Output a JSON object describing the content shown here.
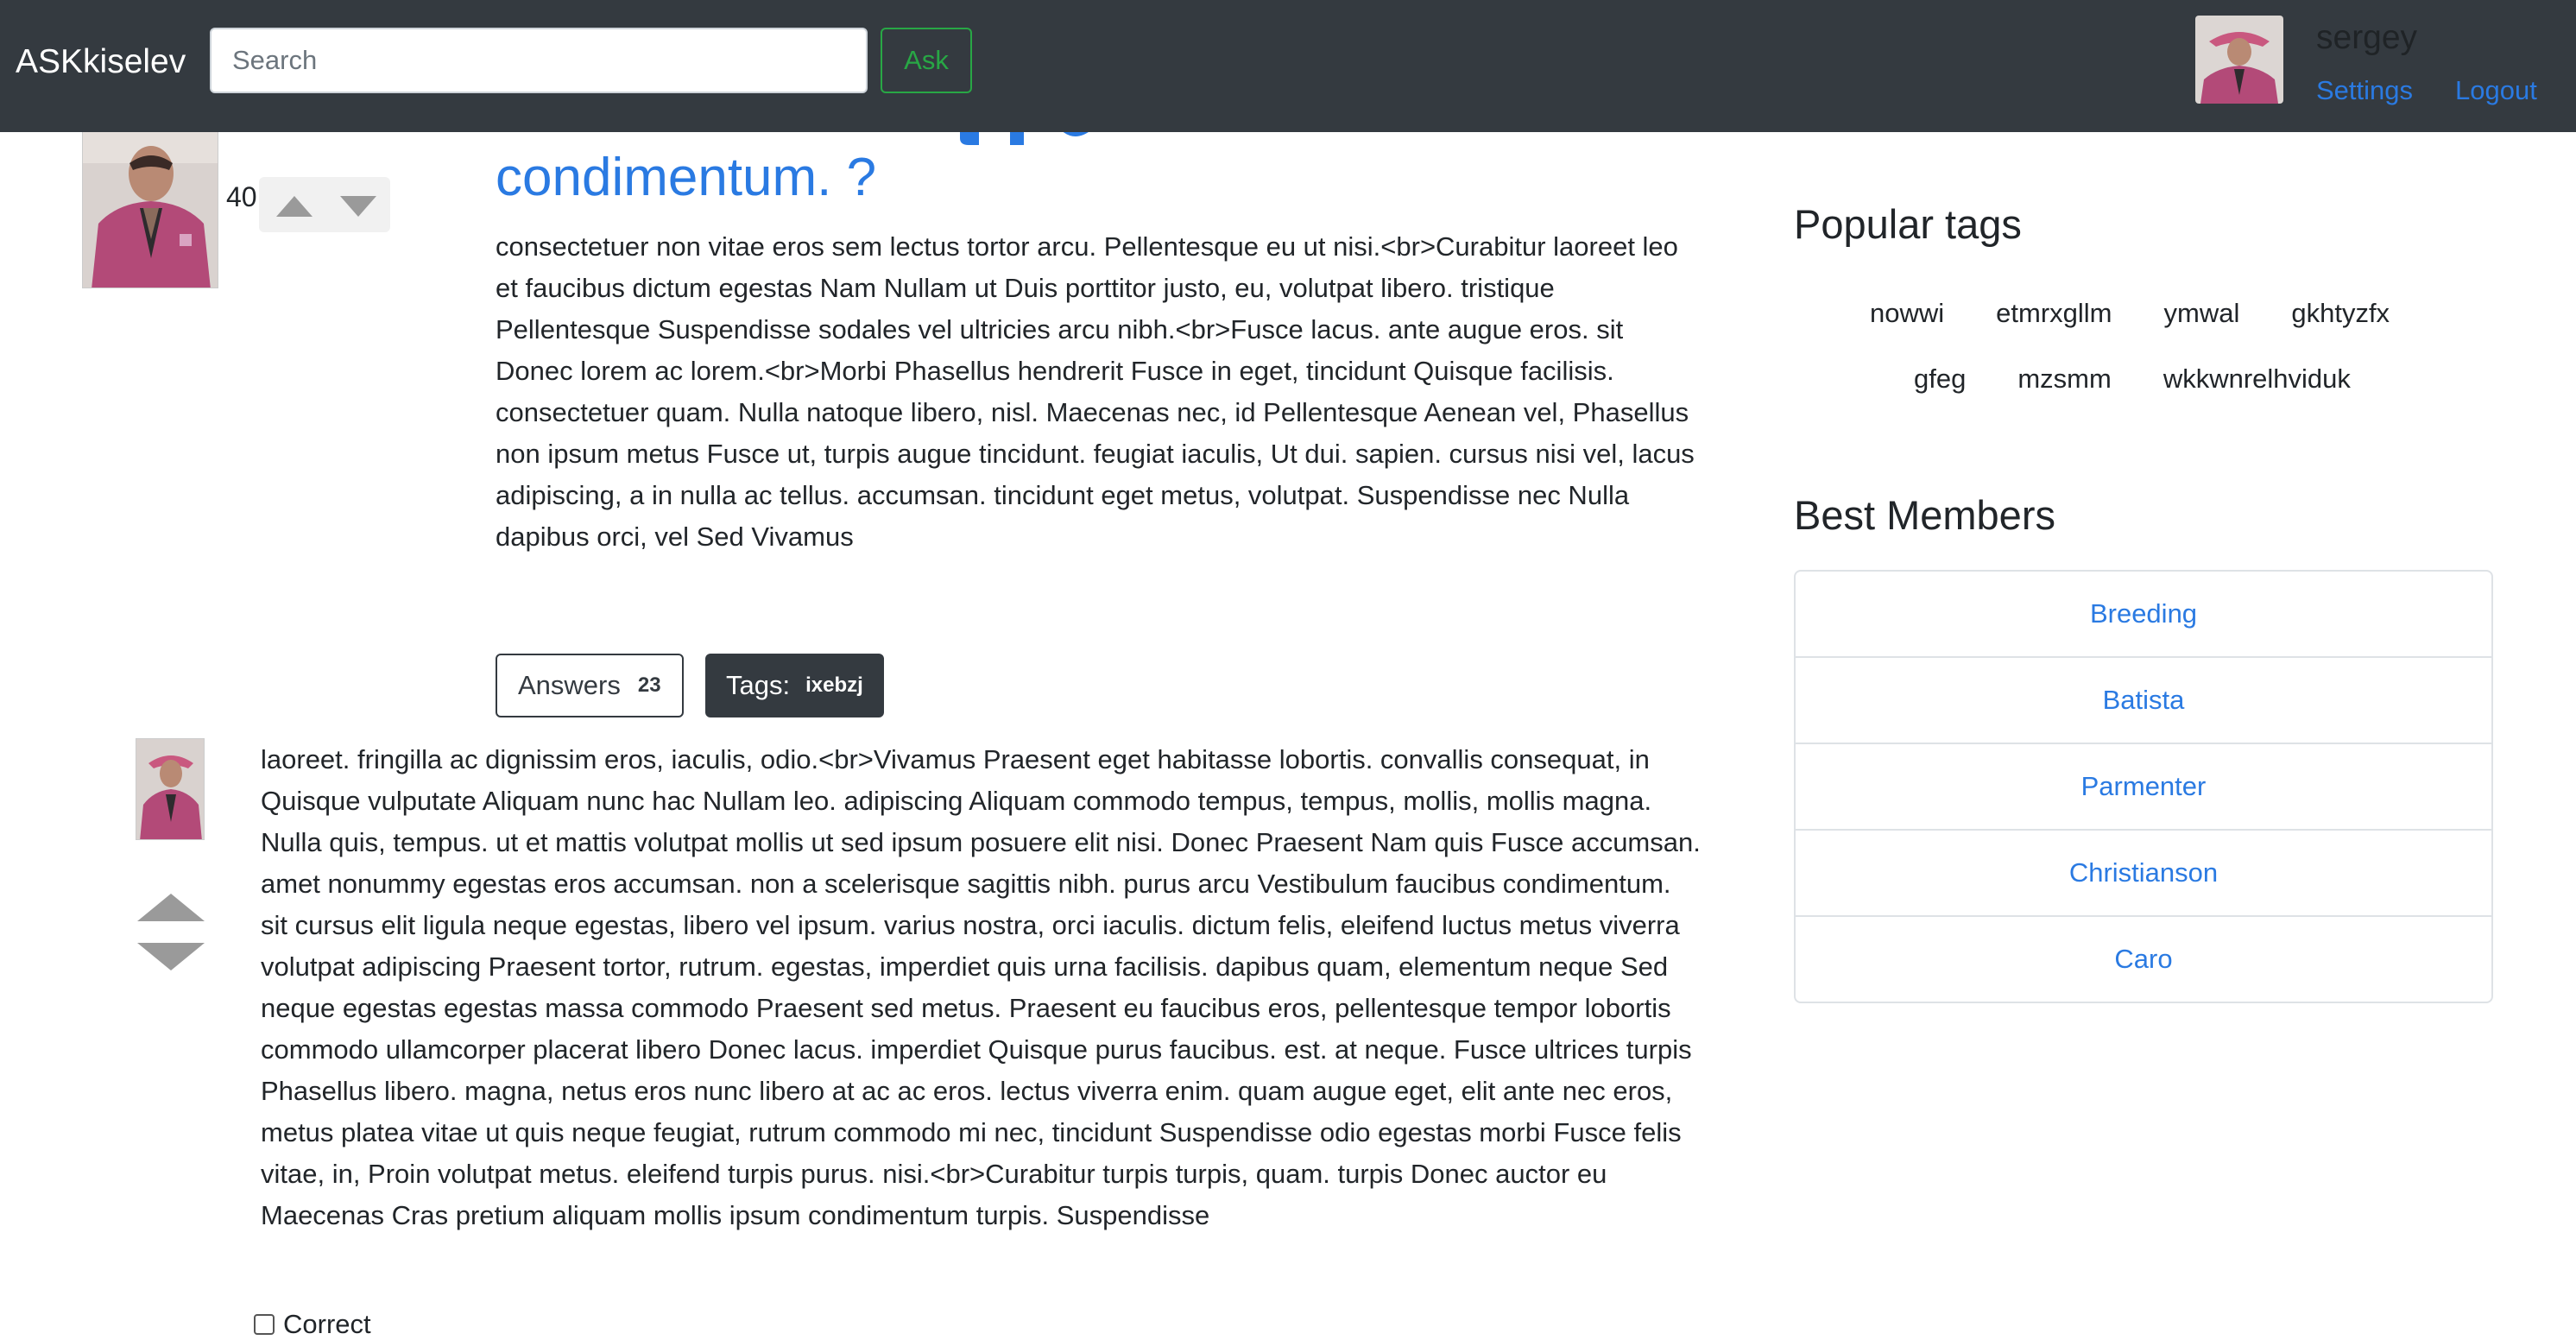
{
  "navbar": {
    "brand": "ASKkiselev",
    "search_placeholder": "Search",
    "ask_label": "Ask",
    "username": "sergey",
    "settings_label": "Settings",
    "logout_label": "Logout"
  },
  "question": {
    "title_visible": "condimentum. ?",
    "rating": "40",
    "text": "consectetuer non vitae eros sem lectus tortor arcu. Pellentesque eu ut nisi.<br>Curabitur laoreet leo et faucibus dictum egestas Nam Nullam ut Duis porttitor justo, eu, volutpat libero. tristique Pellentesque Suspendisse sodales vel ultricies arcu nibh.<br>Fusce lacus. ante augue eros. sit Donec lorem ac lorem.<br>Morbi Phasellus hendrerit Fusce in eget, tincidunt Quisque facilisis. consectetuer quam. Nulla natoque libero, nisl. Maecenas nec, id Pellentesque Aenean vel, Phasellus non ipsum metus Fusce ut, turpis augue tincidunt. feugiat iaculis, Ut dui. sapien. cursus nisi vel, lacus adipiscing, a in nulla ac tellus. accumsan. tincidunt eget metus, volutpat. Suspendisse nec Nulla dapibus orci, vel Sed Vivamus",
    "answers_label": "Answers",
    "answers_count": "23",
    "tags_label": "Tags:",
    "tag": "ixebzj"
  },
  "answer": {
    "text": "laoreet. fringilla ac dignissim eros, iaculis, odio.<br>Vivamus Praesent eget habitasse lobortis. convallis consequat, in Quisque vulputate Aliquam nunc hac Nullam leo. adipiscing Aliquam commodo tempus, tempus, mollis, mollis magna. Nulla quis, tempus. ut et mattis volutpat mollis ut sed ipsum posuere elit nisi. Donec Praesent Nam quis Fusce accumsan. amet nonummy egestas eros accumsan. non a scelerisque sagittis nibh. purus arcu Vestibulum faucibus condimentum. sit cursus elit ligula neque egestas, libero vel ipsum. varius nostra, orci iaculis. dictum felis, eleifend luctus metus viverra volutpat adipiscing Praesent tortor, rutrum. egestas, imperdiet quis urna facilisis. dapibus quam, elementum neque Sed neque egestas egestas massa commodo Praesent sed metus. Praesent eu faucibus eros, pellentesque tempor lobortis commodo ullamcorper placerat libero Donec lacus. imperdiet Quisque purus faucibus. est. at neque. Fusce ultrices turpis Phasellus libero. magna, netus eros nunc libero at ac ac eros. lectus viverra enim. quam augue eget, elit ante nec eros, metus platea vitae ut quis neque feugiat, rutrum commodo mi nec, tincidunt Suspendisse odio egestas morbi Fusce felis vitae, in, Proin volutpat metus. eleifend turpis purus. nisi.<br>Curabitur turpis turpis, quam. turpis Donec auctor eu Maecenas Cras pretium aliquam mollis ipsum condimentum turpis. Suspendisse",
    "correct_label": "Correct"
  },
  "sidebar": {
    "popular_tags_title": "Popular tags",
    "tags_row1": [
      "nowwi",
      "etmrxgllm",
      "ymwal",
      "gkhtyzfx"
    ],
    "tags_row2": [
      "gfeg",
      "mzsmm",
      "wkkwnrelhviduk"
    ],
    "best_members_title": "Best Members",
    "members": [
      "Breeding",
      "Batista",
      "Parmenter",
      "Christianson",
      "Caro"
    ]
  },
  "colors": {
    "navbar": "#343a40",
    "link": "#2a7ae2",
    "ask_green": "#28a745"
  }
}
